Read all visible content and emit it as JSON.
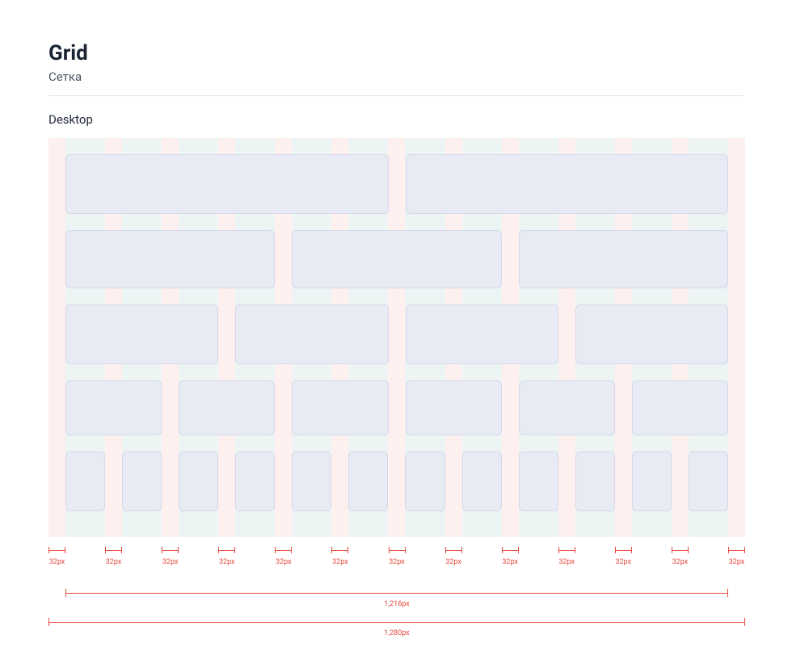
{
  "header": {
    "title": "Grid",
    "subtitle": "Сетка"
  },
  "section": {
    "label": "Desktop"
  },
  "grid": {
    "columns": 12,
    "rows": [
      2,
      3,
      4,
      6,
      12
    ]
  },
  "measurements": {
    "gap_label": "32px",
    "gap_count": 13,
    "inner_width": "1,216px",
    "outer_width": "1,280px"
  },
  "colors": {
    "canvas_bg": "#fdf0ef",
    "column_bg": "#ecf4f4",
    "card_bg": "#e9ebf4",
    "card_border": "#d4d7e8",
    "measure": "#e5493b"
  }
}
